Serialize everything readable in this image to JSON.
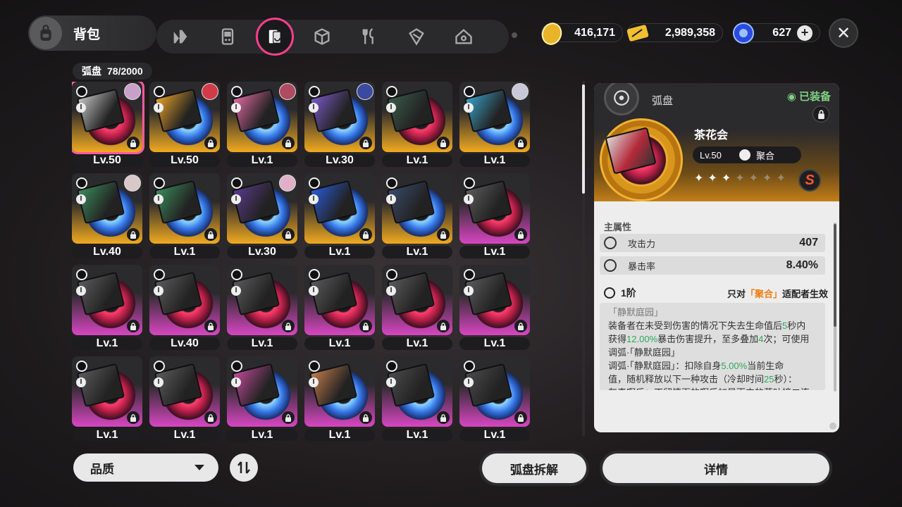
{
  "header": {
    "title": "背包",
    "categories": [
      "agent",
      "gadget",
      "drive-disc",
      "box",
      "food",
      "material",
      "home"
    ],
    "active_category": "drive-disc"
  },
  "currencies": [
    {
      "name": "coin",
      "amount": "416,171"
    },
    {
      "name": "ticket",
      "amount": "2,989,358"
    },
    {
      "name": "polychrome",
      "amount": "627"
    }
  ],
  "inventory": {
    "label": "弧盘",
    "count": "78/2000",
    "items": [
      {
        "lv": "Lv.50",
        "rarity": "gold",
        "disc": "red",
        "box": "#c2c2c2",
        "avatar": "#c8a0c8",
        "selected": true
      },
      {
        "lv": "Lv.50",
        "rarity": "gold",
        "disc": "blue",
        "box": "#e6a028",
        "avatar": "#d23a4a"
      },
      {
        "lv": "Lv.1",
        "rarity": "gold",
        "disc": "blue",
        "box": "#e06aa0",
        "avatar": "#b04a60"
      },
      {
        "lv": "Lv.30",
        "rarity": "gold",
        "disc": "blue",
        "box": "#7a5ac8",
        "avatar": "#3a4aa0"
      },
      {
        "lv": "Lv.1",
        "rarity": "gold",
        "disc": "red",
        "box": "#3a5a4a",
        "avatar": ""
      },
      {
        "lv": "Lv.1",
        "rarity": "gold",
        "disc": "blue",
        "box": "#3aa0c8",
        "avatar": "#c8c8d8"
      },
      {
        "lv": "Lv.40",
        "rarity": "gold",
        "disc": "blue",
        "box": "#3a8a5a",
        "avatar": "#d8c8c8"
      },
      {
        "lv": "Lv.1",
        "rarity": "gold",
        "disc": "blue",
        "box": "#3a8a5a",
        "avatar": ""
      },
      {
        "lv": "Lv.30",
        "rarity": "gold",
        "disc": "blue",
        "box": "#5a3a8a",
        "avatar": "#e0b0c8"
      },
      {
        "lv": "Lv.1",
        "rarity": "gold",
        "disc": "blue",
        "box": "#2a5ad8",
        "avatar": ""
      },
      {
        "lv": "Lv.1",
        "rarity": "gold",
        "disc": "blue",
        "box": "#3a4a6a",
        "avatar": ""
      },
      {
        "lv": "Lv.1",
        "rarity": "pink",
        "disc": "red",
        "box": "#5a5a5c",
        "avatar": ""
      },
      {
        "lv": "Lv.1",
        "rarity": "pink",
        "disc": "red",
        "box": "#5a5a5c",
        "avatar": ""
      },
      {
        "lv": "Lv.40",
        "rarity": "pink",
        "disc": "red",
        "box": "#5a5a5c",
        "avatar": ""
      },
      {
        "lv": "Lv.1",
        "rarity": "pink",
        "disc": "red",
        "box": "#5a5a5c",
        "avatar": ""
      },
      {
        "lv": "Lv.1",
        "rarity": "pink",
        "disc": "red",
        "box": "#5a5a5c",
        "avatar": ""
      },
      {
        "lv": "Lv.1",
        "rarity": "pink",
        "disc": "red",
        "box": "#5a5a5c",
        "avatar": ""
      },
      {
        "lv": "Lv.1",
        "rarity": "pink",
        "disc": "red",
        "box": "#5a5a5c",
        "avatar": ""
      },
      {
        "lv": "Lv.1",
        "rarity": "pink",
        "disc": "red",
        "box": "#5a5a5c",
        "avatar": ""
      },
      {
        "lv": "Lv.1",
        "rarity": "pink",
        "disc": "red",
        "box": "#5a5a5c",
        "avatar": ""
      },
      {
        "lv": "Lv.1",
        "rarity": "pink",
        "disc": "blue",
        "box": "#c04a9a",
        "avatar": ""
      },
      {
        "lv": "Lv.1",
        "rarity": "pink",
        "disc": "blue",
        "box": "#c07a4a",
        "avatar": ""
      },
      {
        "lv": "Lv.1",
        "rarity": "pink",
        "disc": "blue",
        "box": "#4a4a4c",
        "avatar": ""
      },
      {
        "lv": "Lv.1",
        "rarity": "pink",
        "disc": "blue",
        "box": "#4a4a4c",
        "avatar": ""
      }
    ]
  },
  "bottom": {
    "sort_label": "品质",
    "dismantle_label": "弧盘拆解",
    "details_label": "详情"
  },
  "detail": {
    "type_label": "弧盘",
    "equipped_label": "◉ 已装备",
    "name": "茶花会",
    "level": "Lv.50",
    "attribute": "聚合",
    "stars_on": 3,
    "stars_total": 7,
    "rank": "S",
    "main_stat_title": "主属性",
    "stats": [
      {
        "label": "攻击力",
        "value": "407"
      },
      {
        "label": "暴击率",
        "value": "8.40%"
      }
    ],
    "tier": "1阶",
    "tier_note_prefix": "只对",
    "tier_note_attr": "「聚合」",
    "tier_note_suffix": "适配者生效",
    "desc_title": "「静默庭园」",
    "desc_lines": [
      {
        "text": "装备者在未受到伤害的情况下失去生命值后",
        "hl": "5",
        "rest": "秒内"
      },
      {
        "text": "获得",
        "hl": "12.00%",
        "rest": "暴击伤害提升，至多叠加",
        "hl2": "4",
        "rest2": "次；可使用"
      },
      {
        "text": "调弧·「静默庭园」"
      },
      {
        "text": "调弧·「静默庭园」：扣除自身",
        "hl": "5.00%",
        "rest": "当前生命"
      },
      {
        "text": "值，随机释放以下一种攻击（冷却时间",
        "hl": "25",
        "rest": "秒）："
      },
      {
        "text": "灰毒啊乐：不留情面的啊乐加暴雨中的落叶撞二连"
      }
    ]
  }
}
